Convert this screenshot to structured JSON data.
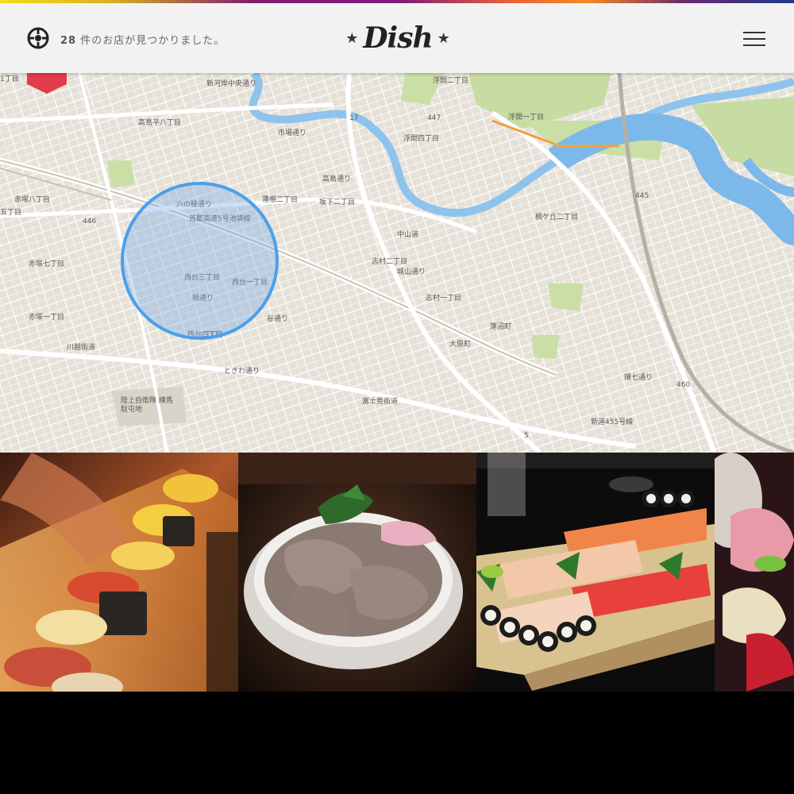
{
  "header": {
    "result_count": "28",
    "result_suffix": "件のお店が見つかりました。",
    "logo_text": "Dish",
    "logo_star": "★"
  },
  "map": {
    "labels": [
      "新河岸中央通り",
      "浮間二丁目",
      "浮間一丁目",
      "浮間四丁目",
      "高島平八丁目",
      "市場通り",
      "中山道",
      "高島通り",
      "蓮根二丁目",
      "坂下二丁目",
      "桐ケ丘二丁目",
      "赤塚八丁目",
      "五丁目",
      "赤塚七丁目",
      "西台三丁目",
      "西台一丁目",
      "志村二丁目",
      "城山通り",
      "志村一丁目",
      "蓮沼町",
      "赤塚一丁目",
      "西台四丁目",
      "大原町",
      "川越街道",
      "陸上自衛隊 練馬駐屯地",
      "富士見街道",
      "ときわ通り",
      "環七通り",
      "首都高速5号池袋線",
      "六の稜通り",
      "446",
      "447",
      "460",
      "17",
      "5",
      "445",
      "1丁目",
      "丁目",
      "桃通り",
      "谷通り",
      "新道455号線"
    ]
  },
  "photos": [
    {
      "name": "sushi-counter"
    },
    {
      "name": "tuna-rice-bowl"
    },
    {
      "name": "sushi-platter"
    },
    {
      "name": "tuna-sushi-closeup"
    }
  ]
}
